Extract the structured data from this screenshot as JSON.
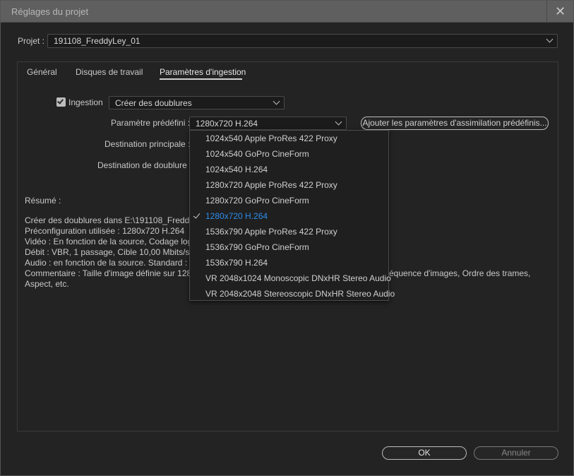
{
  "window": {
    "title": "Réglages du projet",
    "close_symbol": "✕"
  },
  "project": {
    "label": "Projet :",
    "value": "191108_FreddyLey_01"
  },
  "tabs": [
    {
      "label": "Général"
    },
    {
      "label": "Disques de travail"
    },
    {
      "label": "Paramètres d'ingestion"
    }
  ],
  "ingest": {
    "checkbox_label": "Ingestion",
    "checked": true,
    "mode_value": "Créer des doublures",
    "preset_label": "Paramètre prédéfini :",
    "preset_value": "1280x720 H.264",
    "add_preset_button": "Ajouter les paramètres d'assimilation prédéfinis...",
    "primary_dest_label": "Destination principale :",
    "proxy_dest_label": "Destination de doublure :"
  },
  "summary": {
    "title": "Résumé :",
    "lines": [
      "Créer des doublures dans E:\\191108_FreddyLey",
      "Préconfiguration  utilisée : 1280x720 H.264",
      "Vidéo : En fonction de la source, Codage logiciel",
      "Débit : VBR, 1 passage, Cible 10,00  Mbits/s, M",
      "Audio : en fonction de la source. Standard : AA",
      "Commentaire : Taille d'image définie sur 1280",
      "Aspect, etc."
    ],
    "comment_tail": "équence d'images, Ordre des trames,"
  },
  "dropdown": {
    "items": [
      "1024x540 Apple ProRes 422 Proxy",
      "1024x540 GoPro CineForm",
      "1024x540 H.264",
      "1280x720 Apple ProRes 422 Proxy",
      "1280x720 GoPro CineForm",
      "1280x720 H.264",
      "1536x790 Apple ProRes 422 Proxy",
      "1536x790 GoPro CineForm",
      "1536x790 H.264",
      "VR 2048x1024 Monoscopic DNxHR Stereo Audio",
      "VR 2048x2048 Stereoscopic DNxHR Stereo Audio"
    ],
    "selected_index": 5,
    "selected_color": "#2d8ceb"
  },
  "buttons": {
    "ok": "OK",
    "cancel": "Annuler"
  }
}
